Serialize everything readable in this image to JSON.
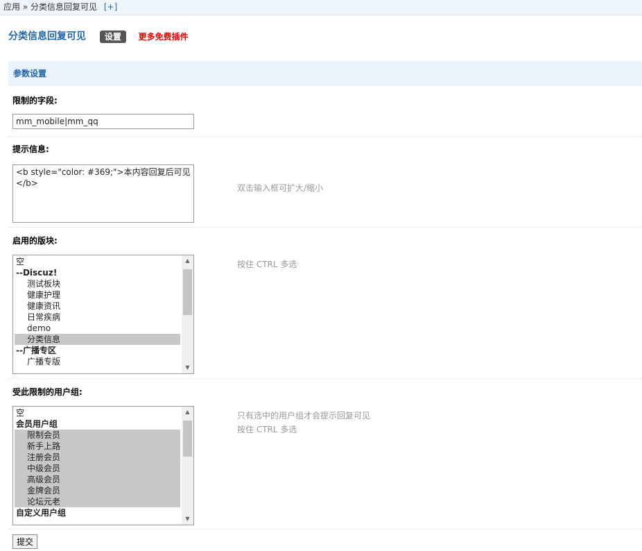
{
  "breadcrumb": {
    "root": "应用",
    "separator": "»",
    "current": "分类信息回复可见",
    "add": "[+]"
  },
  "header": {
    "title": "分类信息回复可见",
    "settings_button": "设置",
    "more_link": "更多免费插件"
  },
  "section": {
    "title": "参数设置"
  },
  "field_limit": {
    "label": "限制的字段:",
    "value": "mm_mobile|mm_qq"
  },
  "field_tip": {
    "label": "提示信息:",
    "value": "<b style=\"color: #369;\">本内容回复后可见</b>",
    "hint": "双击输入框可扩大/缩小"
  },
  "field_forums": {
    "label": "启用的版块:",
    "hint": "按住 CTRL 多选",
    "options": [
      {
        "text": "空",
        "kind": "plain",
        "selected": false
      },
      {
        "text": "--Discuz!",
        "kind": "group",
        "selected": false
      },
      {
        "text": "测试板块",
        "kind": "indent",
        "selected": false
      },
      {
        "text": "健康护理",
        "kind": "indent",
        "selected": false
      },
      {
        "text": "健康资讯",
        "kind": "indent",
        "selected": false
      },
      {
        "text": "日常疾病",
        "kind": "indent",
        "selected": false
      },
      {
        "text": "demo",
        "kind": "indent",
        "selected": false
      },
      {
        "text": "分类信息",
        "kind": "indent",
        "selected": true
      },
      {
        "text": "--广播专区",
        "kind": "group",
        "selected": false
      },
      {
        "text": "广播专版",
        "kind": "indent",
        "selected": false
      }
    ]
  },
  "field_groups": {
    "label": "受此限制的用户组:",
    "hint1": "只有选中的用户组才会提示回复可见",
    "hint2": "按住 CTRL 多选",
    "options": [
      {
        "text": "空",
        "kind": "plain",
        "selected": false
      },
      {
        "text": "会员用户组",
        "kind": "group",
        "selected": false
      },
      {
        "text": "限制会员",
        "kind": "indent",
        "selected": true
      },
      {
        "text": "新手上路",
        "kind": "indent",
        "selected": true
      },
      {
        "text": "注册会员",
        "kind": "indent",
        "selected": true
      },
      {
        "text": "中级会员",
        "kind": "indent",
        "selected": true
      },
      {
        "text": "高级会员",
        "kind": "indent",
        "selected": true
      },
      {
        "text": "金牌会员",
        "kind": "indent",
        "selected": true
      },
      {
        "text": "论坛元老",
        "kind": "indent",
        "selected": true
      },
      {
        "text": "自定义用户组",
        "kind": "group",
        "selected": false
      }
    ]
  },
  "submit": {
    "label": "提交"
  },
  "icons": {
    "scroll_up": "▲",
    "scroll_down": "▼"
  }
}
